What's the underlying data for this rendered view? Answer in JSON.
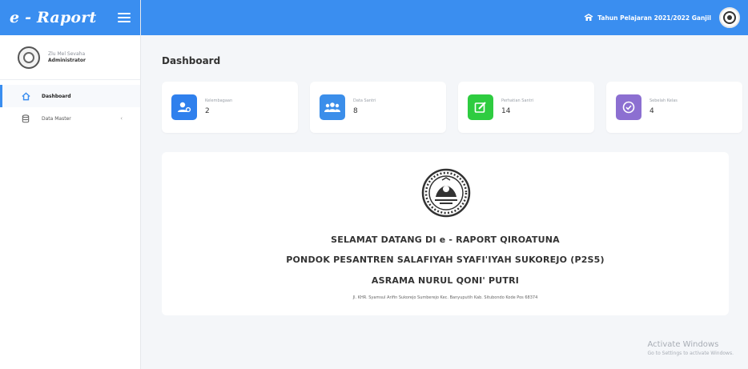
{
  "app": {
    "name": "e - Raport"
  },
  "sidebar": {
    "user": {
      "name": "Zlu Mel Sevaha",
      "role": "Administrator"
    },
    "items": [
      {
        "label": "Dashboard",
        "icon": "home-icon",
        "active": true
      },
      {
        "label": "Data Master",
        "icon": "database-icon",
        "active": false,
        "caret": "‹"
      }
    ]
  },
  "topbar": {
    "school_year": "Tahun Pelajaran 2021/2022 Ganjil"
  },
  "page": {
    "title": "Dashboard"
  },
  "stats": [
    {
      "label": "Kelembagaan",
      "value": "2",
      "icon": "user-cog-icon",
      "color": "#2f80ed"
    },
    {
      "label": "Data Santri",
      "value": "8",
      "icon": "users-icon",
      "color": "#3b8eea"
    },
    {
      "label": "Perhatian Santri",
      "value": "14",
      "icon": "edit-icon",
      "color": "#2ecc40"
    },
    {
      "label": "Sebelah Kelas",
      "value": "4",
      "icon": "check-circle-icon",
      "color": "#8c6fd1"
    }
  ],
  "welcome": {
    "line1": "SELAMAT DATANG DI e - RAPORT QIROATUNA",
    "line2": "PONDOK PESANTREN SALAFIYAH SYAFI'IYAH SUKOREJO (P2S5)",
    "line3": "ASRAMA NURUL QONI' PUTRI",
    "address": "Jl. KHR. Syamsul Arifin Sukorejo Sumberejo Kec. Banyuputih Kab. Situbondo Kode Pos 68374"
  },
  "watermark": {
    "title": "Activate Windows",
    "subtitle": "Go to Settings to activate Windows."
  },
  "colors": {
    "primary": "#3a8ef0"
  }
}
